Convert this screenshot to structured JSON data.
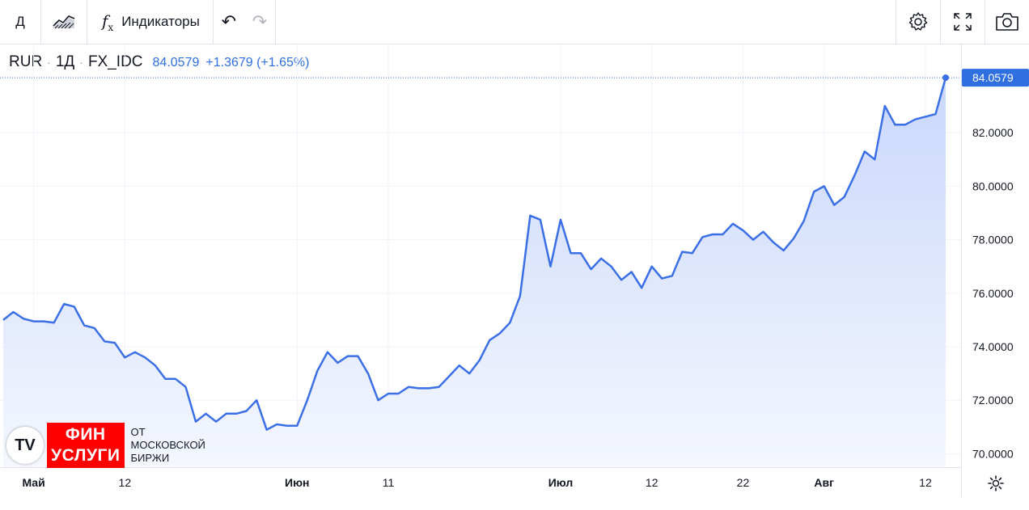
{
  "toolbar": {
    "interval": "Д",
    "indicators_label": "Индикаторы",
    "chart_type_icon": "area-chart-icon",
    "fx_icon": "function-icon",
    "undo_icon": "undo-icon",
    "redo_icon": "redo-icon",
    "settings_icon": "gear-icon",
    "fullscreen_icon": "fullscreen-icon",
    "snapshot_icon": "camera-icon"
  },
  "legend": {
    "symbol": "RUR",
    "interval": "1Д",
    "source": "FX_IDC",
    "value": "84.0579",
    "change": "+1.3679 (+1.65%)"
  },
  "logo": {
    "mark": "TV",
    "line1": "ФИН",
    "line2": "УСЛУГИ",
    "sub1": "ОТ",
    "sub2": "МОСКОВСКОЙ",
    "sub3": "БИРЖИ"
  },
  "colors": {
    "line": "#3b6fe6",
    "fill_top": "#c9d7fb",
    "fill_bottom": "#f4f7fe",
    "price_tag": "#2f6fe0",
    "grid": "#f0f3fa"
  },
  "chart_data": {
    "type": "area",
    "title": "",
    "xlabel": "",
    "ylabel": "",
    "ylim": [
      69.5,
      85.3
    ],
    "y_ticks": [
      "70.0000",
      "72.0000",
      "74.0000",
      "76.0000",
      "78.0000",
      "80.0000",
      "82.0000"
    ],
    "last_value_label": "84.0579",
    "x_ticks": [
      {
        "label": "Май",
        "index": 3,
        "bold": true
      },
      {
        "label": "12",
        "index": 12,
        "bold": false
      },
      {
        "label": "Июн",
        "index": 29,
        "bold": true
      },
      {
        "label": "11",
        "index": 38,
        "bold": false
      },
      {
        "label": "Июл",
        "index": 55,
        "bold": true
      },
      {
        "label": "12",
        "index": 64,
        "bold": false
      },
      {
        "label": "22",
        "index": 73,
        "bold": false
      },
      {
        "label": "Авг",
        "index": 81,
        "bold": true
      },
      {
        "label": "12",
        "index": 91,
        "bold": false
      }
    ],
    "values": [
      75.0,
      75.3,
      75.05,
      74.95,
      74.95,
      74.9,
      75.6,
      75.5,
      74.8,
      74.7,
      74.2,
      74.15,
      73.6,
      73.8,
      73.6,
      73.3,
      72.8,
      72.8,
      72.5,
      71.2,
      71.5,
      71.2,
      71.5,
      71.5,
      71.6,
      72.0,
      70.9,
      71.1,
      71.05,
      71.05,
      72.0,
      73.1,
      73.8,
      73.4,
      73.65,
      73.65,
      73.0,
      72.0,
      72.25,
      72.25,
      72.5,
      72.45,
      72.45,
      72.5,
      72.9,
      73.3,
      73.0,
      73.5,
      74.25,
      74.5,
      74.9,
      75.9,
      78.9,
      78.75,
      77.0,
      78.75,
      77.5,
      77.5,
      76.9,
      77.3,
      77.0,
      76.5,
      76.8,
      76.2,
      77.0,
      76.55,
      76.65,
      77.55,
      77.5,
      78.1,
      78.2,
      78.2,
      78.6,
      78.35,
      78.0,
      78.3,
      77.9,
      77.6,
      78.05,
      78.7,
      79.8,
      80.0,
      79.3,
      79.6,
      80.4,
      81.3,
      81.0,
      83.0,
      82.3,
      82.3,
      82.5,
      82.6,
      82.7,
      84.0579
    ]
  }
}
